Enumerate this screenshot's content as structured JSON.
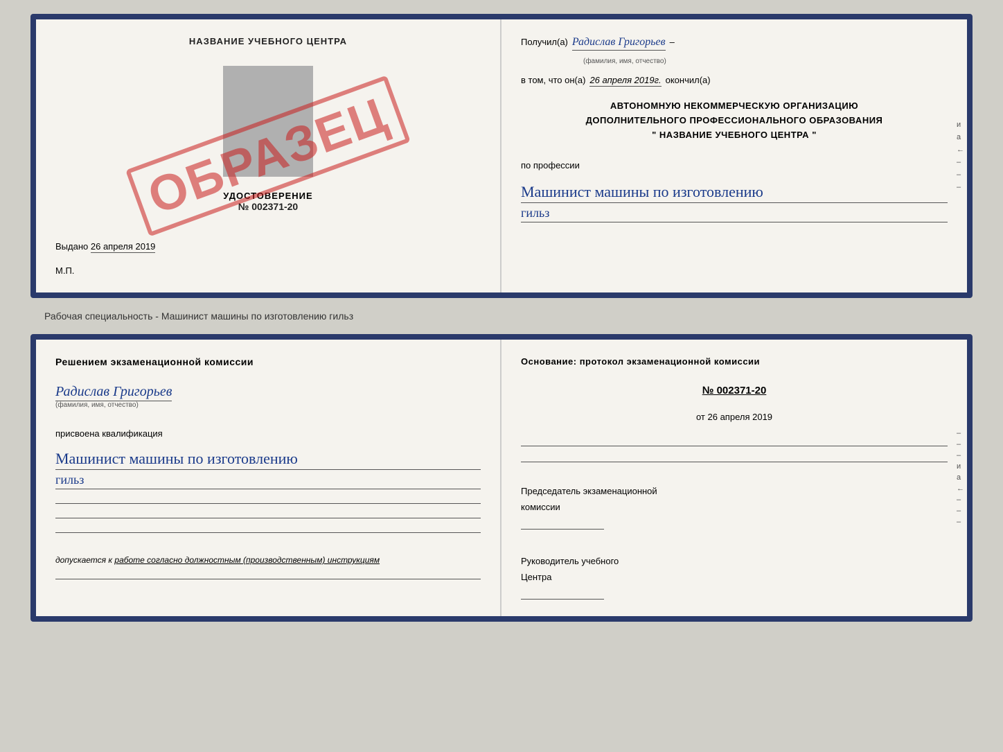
{
  "top_doc": {
    "left": {
      "title": "НАЗВАНИЕ УЧЕБНОГО ЦЕНТРА",
      "udostoverenie_label": "УДОСТОВЕРЕНИЕ",
      "number": "№ 002371-20",
      "vydano": "Выдано",
      "vydano_date": "26 апреля 2019",
      "mp": "М.П.",
      "obrazec": "ОБРАЗЕЦ"
    },
    "right": {
      "poluchil_prefix": "Получил(а)",
      "recipient_name": "Радислав Григорьев",
      "fio_label": "(фамилия, имя, отчество)",
      "dash1": "–",
      "vtom_prefix": "в том, что он(а)",
      "vtom_date": "26 апреля 2019г.",
      "okonchil": "окончил(а)",
      "org_line1": "АВТОНОМНУЮ НЕКОММЕРЧЕСКУЮ ОРГАНИЗАЦИЮ",
      "org_line2": "ДОПОЛНИТЕЛЬНОГО ПРОФЕССИОНАЛЬНОГО ОБРАЗОВАНИЯ",
      "org_quote1": "\"",
      "org_name": "НАЗВАНИЕ УЧЕБНОГО ЦЕНТРА",
      "org_quote2": "\"",
      "po_professii": "по профессии",
      "profession1": "Машинист машины по изготовлению",
      "profession2": "гильз",
      "side_marks": [
        "и",
        "а",
        "←",
        "–",
        "–",
        "–"
      ]
    }
  },
  "separator": {
    "text": "Рабочая специальность - Машинист машины по изготовлению гильз"
  },
  "bottom_doc": {
    "left": {
      "resheniem": "Решением экзаменационной комиссии",
      "name": "Радислав Григорьев",
      "fio_label": "(фамилия, имя, отчество)",
      "prisvoena": "присвоена квалификация",
      "qualification1": "Машинист машины по изготовлению",
      "qualification2": "гильз",
      "dopuskaetsya_prefix": "допускается к",
      "dopuskaetsya_text": "работе согласно должностным (производственным) инструкциям"
    },
    "right": {
      "osnovanie": "Основание: протокол экзаменационной комиссии",
      "number": "№ 002371-20",
      "ot_prefix": "от",
      "ot_date": "26 апреля 2019",
      "chairman_title": "Председатель экзаменационной",
      "chairman_title2": "комиссии",
      "rukovoditel_title": "Руководитель учебного",
      "rukovoditel_title2": "Центра",
      "side_marks": [
        "–",
        "–",
        "–",
        "и",
        "а",
        "←",
        "–",
        "–",
        "–"
      ]
    }
  }
}
